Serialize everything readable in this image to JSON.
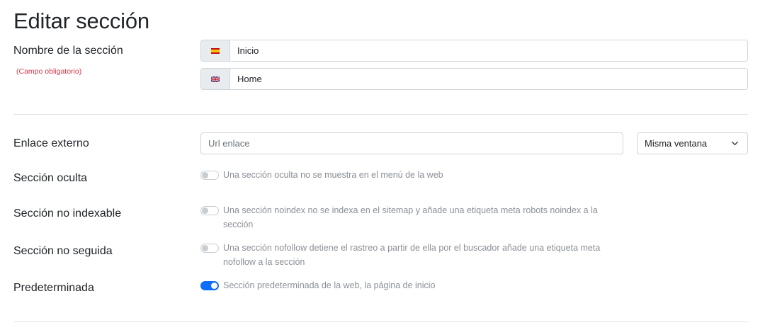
{
  "page_title": "Editar sección",
  "section_name": {
    "label": "Nombre de la sección",
    "required_note": "(Campo obligatorio)",
    "fields": [
      {
        "lang": "es",
        "value": "Inicio"
      },
      {
        "lang": "en",
        "value": "Home"
      }
    ]
  },
  "external_link": {
    "label": "Enlace externo",
    "url_placeholder": "Url enlace",
    "target_select": {
      "selected": "Misma ventana"
    }
  },
  "hidden": {
    "label": "Sección oculta",
    "description": "Una sección oculta no se muestra en el menú de la web",
    "checked": false
  },
  "noindex": {
    "label": "Sección no indexable",
    "description_line1": "Una sección noindex no se indexa en el sitemap y añade una etiqueta meta robots noindex a la",
    "description_line2": "sección",
    "checked": false
  },
  "nofollow": {
    "label": "Sección no seguida",
    "description_line1": "Una sección nofollow detiene el rastreo a partir de ella por el buscador añade una etiqueta meta",
    "description_line2": "nofollow a la sección",
    "checked": false
  },
  "default": {
    "label": "Predeterminada",
    "description": "Sección predeterminada de la web, la página de inicio",
    "checked": true
  },
  "colors": {
    "required": "#dc3545",
    "switch_on": "#0d6efd",
    "muted_text": "#8a9096"
  },
  "icons": {
    "flag_es": "spain-flag-icon",
    "flag_en": "uk-flag-icon",
    "select_arrow": "chevron-down-icon"
  }
}
